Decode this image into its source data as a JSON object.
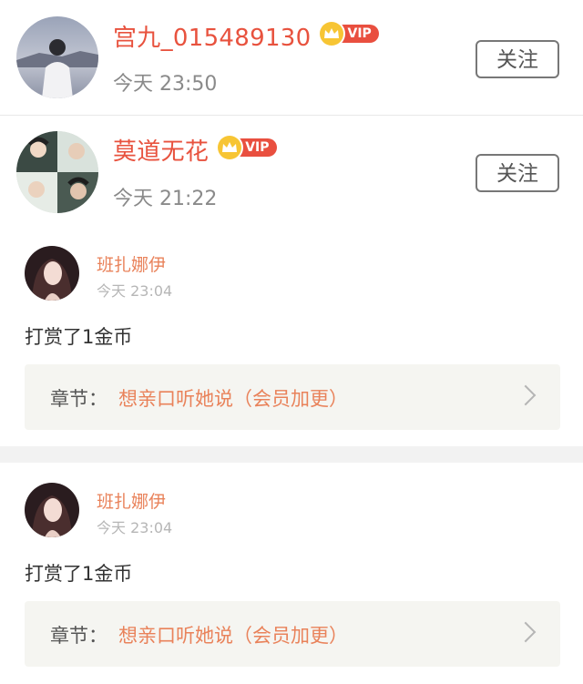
{
  "follow_list": [
    {
      "name": "宫九_015489130",
      "vip": "VIP",
      "time": "今天 23:50",
      "button": "关注"
    },
    {
      "name": "莫道无花",
      "vip": "VIP",
      "time": "今天 21:22",
      "button": "关注"
    }
  ],
  "tips": [
    {
      "name": "班扎娜伊",
      "time": "今天 23:04",
      "message": "打赏了1金币",
      "chapter_label": "章节：",
      "chapter_title": "想亲口听她说（会员加更）"
    },
    {
      "name": "班扎娜伊",
      "time": "今天 23:04",
      "message": "打赏了1金币",
      "chapter_label": "章节：",
      "chapter_title": "想亲口听她说（会员加更）"
    }
  ],
  "colors": {
    "username": "#e8523e",
    "vip_badge": "#e94f3f",
    "crown": "#f7c534",
    "tip_accent": "#e9825a",
    "chapter_bg": "#f5f5f1"
  }
}
